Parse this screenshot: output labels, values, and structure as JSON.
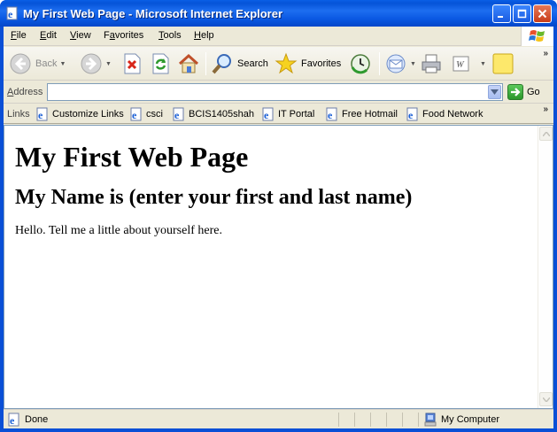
{
  "window": {
    "title": "My First Web Page - Microsoft Internet Explorer"
  },
  "menu": {
    "items": [
      {
        "accel": "F",
        "rest": "ile"
      },
      {
        "accel": "E",
        "rest": "dit"
      },
      {
        "accel": "V",
        "rest": "iew"
      },
      {
        "accel": "",
        "pre": "F",
        "accel2": "a",
        "rest": "vorites"
      },
      {
        "accel": "T",
        "rest": "ools"
      },
      {
        "accel": "H",
        "rest": "elp"
      }
    ]
  },
  "toolbar": {
    "back_label": "Back",
    "search_label": "Search",
    "favorites_label": "Favorites"
  },
  "address": {
    "label_accel": "A",
    "label_rest": "ddress",
    "value": "",
    "go_label": "Go"
  },
  "links": {
    "label": "Links",
    "items": [
      "Customize Links",
      "csci",
      "BCIS1405shah",
      "IT Portal",
      "Free Hotmail",
      "Food Network"
    ]
  },
  "page": {
    "h1": "My First Web Page",
    "h2": "My Name is (enter your first and last name)",
    "paragraph": "Hello. Tell me a little about yourself here."
  },
  "status": {
    "text": "Done",
    "zone": "My Computer"
  },
  "colors": {
    "titlebar": "#0553d8",
    "frame": "#ece9d8",
    "close_button": "#c83d1a"
  }
}
